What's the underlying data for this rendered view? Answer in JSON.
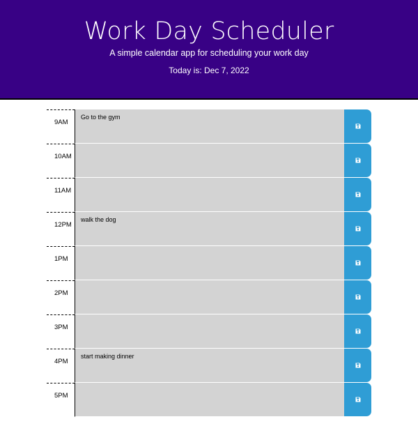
{
  "header": {
    "title": "Work Day Scheduler",
    "subtitle": "A simple calendar app for scheduling your work day",
    "today": "Today is: Dec 7, 2022"
  },
  "colors": {
    "header_bg": "#380185",
    "slot_bg": "#d3d3d3",
    "save_button": "#2f9dd5"
  },
  "slots": [
    {
      "hour": "9AM",
      "text": "Go to the gym"
    },
    {
      "hour": "10AM",
      "text": ""
    },
    {
      "hour": "11AM",
      "text": ""
    },
    {
      "hour": "12PM",
      "text": "walk the dog"
    },
    {
      "hour": "1PM",
      "text": ""
    },
    {
      "hour": "2PM",
      "text": ""
    },
    {
      "hour": "3PM",
      "text": ""
    },
    {
      "hour": "4PM",
      "text": "start making dinner"
    },
    {
      "hour": "5PM",
      "text": ""
    }
  ],
  "save_icon": "floppy-disk-icon"
}
